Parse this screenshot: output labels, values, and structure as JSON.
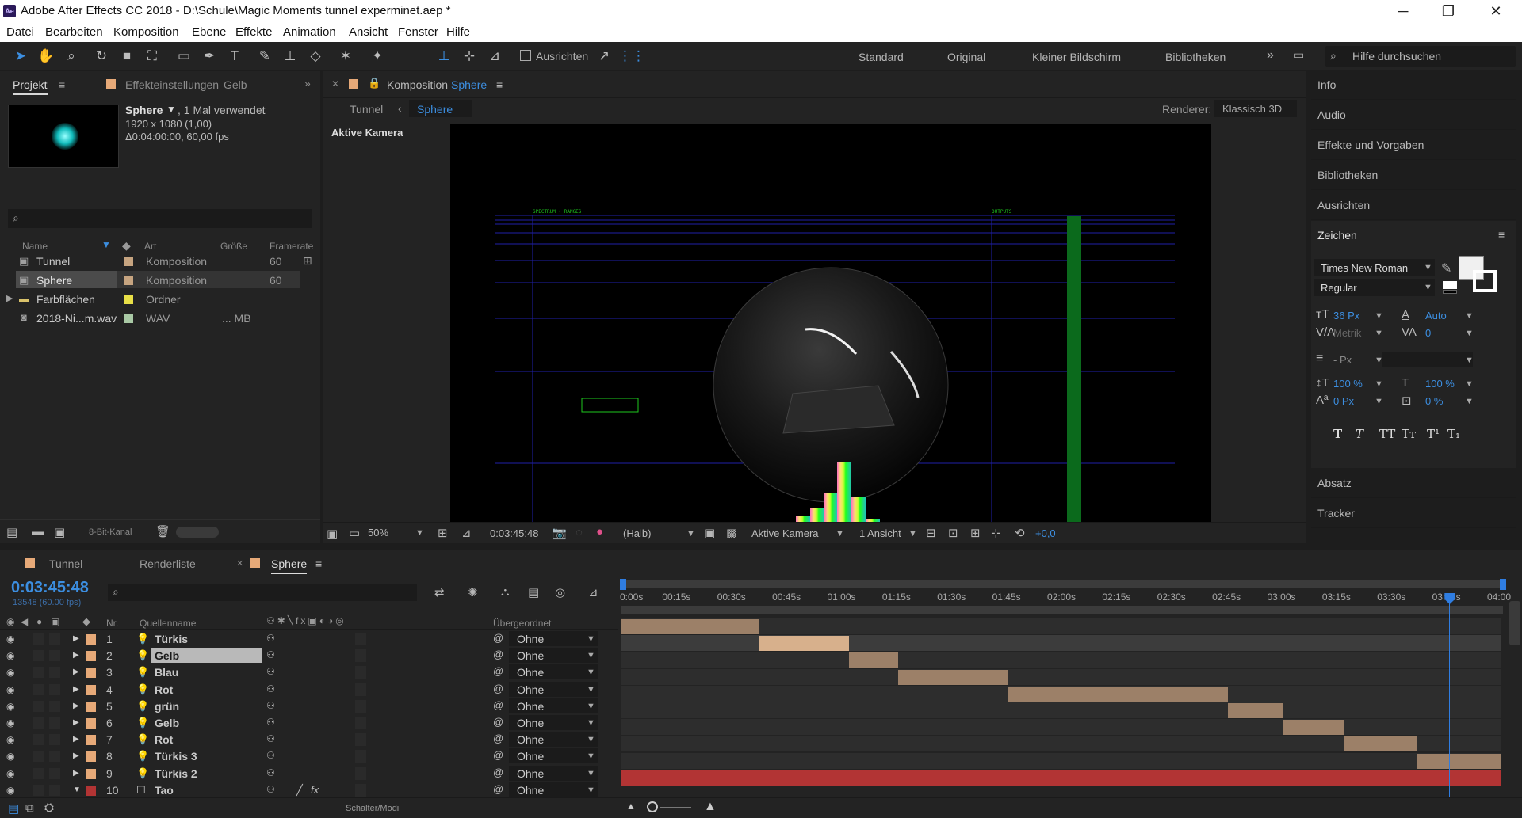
{
  "window": {
    "title": "Adobe After Effects CC 2018 - D:\\Schule\\Magic Moments tunnel experminet.aep *",
    "app_icon": "Ae",
    "min": "─",
    "restore": "❐",
    "close": "✕"
  },
  "menu": [
    "Datei",
    "Bearbeiten",
    "Komposition",
    "Ebene",
    "Effekte",
    "Animation",
    "Ansicht",
    "Fenster",
    "Hilfe"
  ],
  "toolbar": {
    "align_label": "Ausrichten",
    "workspaces": [
      "Standard",
      "Original",
      "Kleiner Bildschirm",
      "Bibliotheken"
    ],
    "search_placeholder": "Hilfe durchsuchen"
  },
  "project": {
    "tab_label": "Projekt",
    "effects_tab": "Effekteinstellungen",
    "effects_target": "Gelb",
    "selected_name": "Sphere",
    "usage": ", 1 Mal verwendet",
    "resolution": "1920 x 1080 (1,00)",
    "duration": "Δ0:04:00:00, 60,00 fps",
    "columns": [
      "Name",
      "Art",
      "Größe",
      "Framerate"
    ],
    "items": [
      {
        "name": "Tunnel",
        "type": "Komposition",
        "size": "",
        "fps": "60"
      },
      {
        "name": "Sphere",
        "type": "Komposition",
        "size": "",
        "fps": "60"
      },
      {
        "name": "Farbflächen",
        "type": "Ordner",
        "size": "",
        "fps": ""
      },
      {
        "name": "2018-Ni...m.wav",
        "type": "WAV",
        "size": "... MB",
        "fps": ""
      }
    ],
    "bit_depth": "8-Bit-Kanal"
  },
  "comp": {
    "tab_prefix": "Komposition",
    "tab_name": "Sphere",
    "nav_parent": "Tunnel",
    "nav_current": "Sphere",
    "renderer_label": "Renderer:",
    "renderer_value": "Klassisch 3D",
    "camera_label": "Aktive Kamera",
    "canvas_left_label": "SPECTRUM • RANGES",
    "canvas_right_label": "OUTPUTS",
    "zoom": "50%",
    "timecode": "0:03:45:48",
    "resolution": "(Halb)",
    "camera": "Aktive Kamera",
    "views": "1 Ansicht",
    "exposure": "+0,0"
  },
  "right_panel": {
    "items": [
      "Info",
      "Audio",
      "Effekte und Vorgaben",
      "Bibliotheken",
      "Ausrichten",
      "Zeichen"
    ],
    "font": "Times New Roman",
    "style": "Regular",
    "size": "36 Px",
    "leading": "Auto",
    "kerning": "Metrik",
    "tracking": "0",
    "stroke": "- Px",
    "vscale": "100 %",
    "hscale": "100 %",
    "baseline": "0 Px",
    "tsume": "0 %",
    "type_buttons": [
      "T",
      "T",
      "TT",
      "Tт",
      "T¹",
      "T₁"
    ],
    "bottom_items": [
      "Absatz",
      "Tracker"
    ]
  },
  "timeline": {
    "tabs": [
      "Tunnel",
      "Renderliste",
      "Sphere"
    ],
    "timecode": "0:03:45:48",
    "frames": "13548 (60.00 fps)",
    "col_nr": "Nr.",
    "col_source": "Quellenname",
    "col_parent": "Übergeordnet",
    "ruler": [
      "0:00s",
      "00:15s",
      "00:30s",
      "00:45s",
      "01:00s",
      "01:15s",
      "01:30s",
      "01:45s",
      "02:00s",
      "02:15s",
      "02:30s",
      "02:45s",
      "03:00s",
      "03:15s",
      "03:30s",
      "03:45s",
      "04:00"
    ],
    "layers": [
      {
        "nr": "1",
        "name": "Türkis",
        "parent": "Ohne",
        "in": 0,
        "out": 37.5
      },
      {
        "nr": "2",
        "name": "Gelb",
        "parent": "Ohne",
        "in": 37.5,
        "out": 62
      },
      {
        "nr": "3",
        "name": "Blau",
        "parent": "Ohne",
        "in": 62,
        "out": 75.5
      },
      {
        "nr": "4",
        "name": "Rot",
        "parent": "Ohne",
        "in": 75.5,
        "out": 105.5
      },
      {
        "nr": "5",
        "name": "grün",
        "parent": "Ohne",
        "in": 105.5,
        "out": 165.5
      },
      {
        "nr": "6",
        "name": "Gelb",
        "parent": "Ohne",
        "in": 165.5,
        "out": 180.5
      },
      {
        "nr": "7",
        "name": "Rot",
        "parent": "Ohne",
        "in": 180.5,
        "out": 197
      },
      {
        "nr": "8",
        "name": "Türkis 3",
        "parent": "Ohne",
        "in": 197,
        "out": 217
      },
      {
        "nr": "9",
        "name": "Türkis 2",
        "parent": "Ohne",
        "in": 217,
        "out": 240
      },
      {
        "nr": "10",
        "name": "Tao",
        "parent": "Ohne",
        "in": 0,
        "out": 240
      }
    ],
    "switches_label": "Schalter/Modi",
    "duration_seconds": 240,
    "playhead_seconds": 225.8
  },
  "colors": {
    "layer_label": "#e6a978",
    "text_layer": "#b23434",
    "playhead": "#2f7de1",
    "bar": "#9c8068",
    "bar_selected": "#d7b08c"
  }
}
